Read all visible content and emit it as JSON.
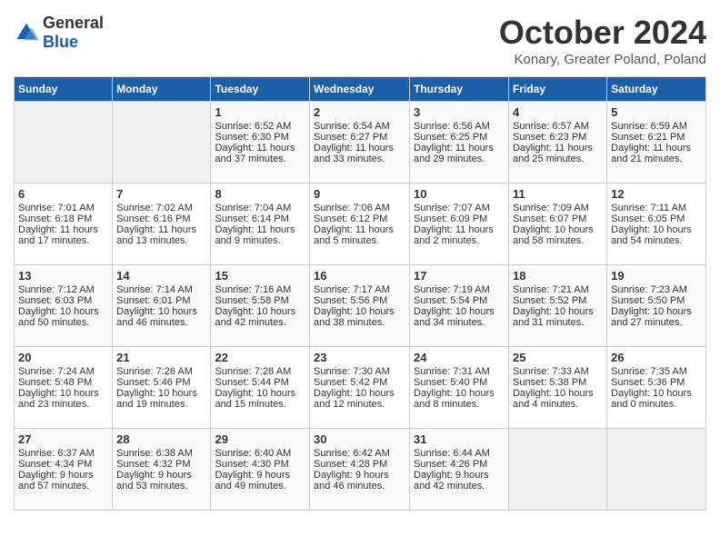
{
  "header": {
    "logo": {
      "general": "General",
      "blue": "Blue"
    },
    "title": "October 2024",
    "location": "Konary, Greater Poland, Poland"
  },
  "days_of_week": [
    "Sunday",
    "Monday",
    "Tuesday",
    "Wednesday",
    "Thursday",
    "Friday",
    "Saturday"
  ],
  "weeks": [
    [
      {
        "day": "",
        "empty": true
      },
      {
        "day": "",
        "empty": true
      },
      {
        "day": "1",
        "sunrise": "Sunrise: 6:52 AM",
        "sunset": "Sunset: 6:30 PM",
        "daylight": "Daylight: 11 hours and 37 minutes."
      },
      {
        "day": "2",
        "sunrise": "Sunrise: 6:54 AM",
        "sunset": "Sunset: 6:27 PM",
        "daylight": "Daylight: 11 hours and 33 minutes."
      },
      {
        "day": "3",
        "sunrise": "Sunrise: 6:56 AM",
        "sunset": "Sunset: 6:25 PM",
        "daylight": "Daylight: 11 hours and 29 minutes."
      },
      {
        "day": "4",
        "sunrise": "Sunrise: 6:57 AM",
        "sunset": "Sunset: 6:23 PM",
        "daylight": "Daylight: 11 hours and 25 minutes."
      },
      {
        "day": "5",
        "sunrise": "Sunrise: 6:59 AM",
        "sunset": "Sunset: 6:21 PM",
        "daylight": "Daylight: 11 hours and 21 minutes."
      }
    ],
    [
      {
        "day": "6",
        "sunrise": "Sunrise: 7:01 AM",
        "sunset": "Sunset: 6:18 PM",
        "daylight": "Daylight: 11 hours and 17 minutes."
      },
      {
        "day": "7",
        "sunrise": "Sunrise: 7:02 AM",
        "sunset": "Sunset: 6:16 PM",
        "daylight": "Daylight: 11 hours and 13 minutes."
      },
      {
        "day": "8",
        "sunrise": "Sunrise: 7:04 AM",
        "sunset": "Sunset: 6:14 PM",
        "daylight": "Daylight: 11 hours and 9 minutes."
      },
      {
        "day": "9",
        "sunrise": "Sunrise: 7:06 AM",
        "sunset": "Sunset: 6:12 PM",
        "daylight": "Daylight: 11 hours and 5 minutes."
      },
      {
        "day": "10",
        "sunrise": "Sunrise: 7:07 AM",
        "sunset": "Sunset: 6:09 PM",
        "daylight": "Daylight: 11 hours and 2 minutes."
      },
      {
        "day": "11",
        "sunrise": "Sunrise: 7:09 AM",
        "sunset": "Sunset: 6:07 PM",
        "daylight": "Daylight: 10 hours and 58 minutes."
      },
      {
        "day": "12",
        "sunrise": "Sunrise: 7:11 AM",
        "sunset": "Sunset: 6:05 PM",
        "daylight": "Daylight: 10 hours and 54 minutes."
      }
    ],
    [
      {
        "day": "13",
        "sunrise": "Sunrise: 7:12 AM",
        "sunset": "Sunset: 6:03 PM",
        "daylight": "Daylight: 10 hours and 50 minutes."
      },
      {
        "day": "14",
        "sunrise": "Sunrise: 7:14 AM",
        "sunset": "Sunset: 6:01 PM",
        "daylight": "Daylight: 10 hours and 46 minutes."
      },
      {
        "day": "15",
        "sunrise": "Sunrise: 7:16 AM",
        "sunset": "Sunset: 5:58 PM",
        "daylight": "Daylight: 10 hours and 42 minutes."
      },
      {
        "day": "16",
        "sunrise": "Sunrise: 7:17 AM",
        "sunset": "Sunset: 5:56 PM",
        "daylight": "Daylight: 10 hours and 38 minutes."
      },
      {
        "day": "17",
        "sunrise": "Sunrise: 7:19 AM",
        "sunset": "Sunset: 5:54 PM",
        "daylight": "Daylight: 10 hours and 34 minutes."
      },
      {
        "day": "18",
        "sunrise": "Sunrise: 7:21 AM",
        "sunset": "Sunset: 5:52 PM",
        "daylight": "Daylight: 10 hours and 31 minutes."
      },
      {
        "day": "19",
        "sunrise": "Sunrise: 7:23 AM",
        "sunset": "Sunset: 5:50 PM",
        "daylight": "Daylight: 10 hours and 27 minutes."
      }
    ],
    [
      {
        "day": "20",
        "sunrise": "Sunrise: 7:24 AM",
        "sunset": "Sunset: 5:48 PM",
        "daylight": "Daylight: 10 hours and 23 minutes."
      },
      {
        "day": "21",
        "sunrise": "Sunrise: 7:26 AM",
        "sunset": "Sunset: 5:46 PM",
        "daylight": "Daylight: 10 hours and 19 minutes."
      },
      {
        "day": "22",
        "sunrise": "Sunrise: 7:28 AM",
        "sunset": "Sunset: 5:44 PM",
        "daylight": "Daylight: 10 hours and 15 minutes."
      },
      {
        "day": "23",
        "sunrise": "Sunrise: 7:30 AM",
        "sunset": "Sunset: 5:42 PM",
        "daylight": "Daylight: 10 hours and 12 minutes."
      },
      {
        "day": "24",
        "sunrise": "Sunrise: 7:31 AM",
        "sunset": "Sunset: 5:40 PM",
        "daylight": "Daylight: 10 hours and 8 minutes."
      },
      {
        "day": "25",
        "sunrise": "Sunrise: 7:33 AM",
        "sunset": "Sunset: 5:38 PM",
        "daylight": "Daylight: 10 hours and 4 minutes."
      },
      {
        "day": "26",
        "sunrise": "Sunrise: 7:35 AM",
        "sunset": "Sunset: 5:36 PM",
        "daylight": "Daylight: 10 hours and 0 minutes."
      }
    ],
    [
      {
        "day": "27",
        "sunrise": "Sunrise: 6:37 AM",
        "sunset": "Sunset: 4:34 PM",
        "daylight": "Daylight: 9 hours and 57 minutes."
      },
      {
        "day": "28",
        "sunrise": "Sunrise: 6:38 AM",
        "sunset": "Sunset: 4:32 PM",
        "daylight": "Daylight: 9 hours and 53 minutes."
      },
      {
        "day": "29",
        "sunrise": "Sunrise: 6:40 AM",
        "sunset": "Sunset: 4:30 PM",
        "daylight": "Daylight: 9 hours and 49 minutes."
      },
      {
        "day": "30",
        "sunrise": "Sunrise: 6:42 AM",
        "sunset": "Sunset: 4:28 PM",
        "daylight": "Daylight: 9 hours and 46 minutes."
      },
      {
        "day": "31",
        "sunrise": "Sunrise: 6:44 AM",
        "sunset": "Sunset: 4:26 PM",
        "daylight": "Daylight: 9 hours and 42 minutes."
      },
      {
        "day": "",
        "empty": true
      },
      {
        "day": "",
        "empty": true
      }
    ]
  ]
}
